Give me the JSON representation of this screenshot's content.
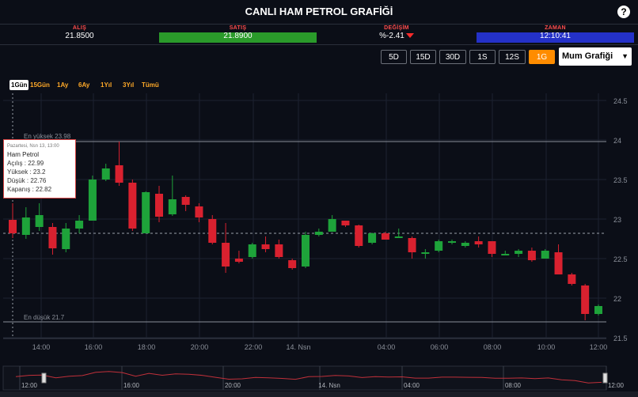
{
  "header": {
    "title": "CANLI HAM PETROL GRAFİĞİ",
    "help_label": "?"
  },
  "stats": {
    "bid_label": "ALIŞ",
    "bid_value": "21.8500",
    "ask_label": "SATIŞ",
    "ask_value": "21.8900",
    "change_label": "DEĞİŞİM",
    "change_value": "%-2.41",
    "time_label": "ZAMAN",
    "time_value": "12:10:41"
  },
  "colors": {
    "up": "#1ea33a",
    "down": "#d9212f",
    "accent": "#ff8c00",
    "ask_bar": "#2a9a2a",
    "time_bar": "#2431c8"
  },
  "period_buttons": [
    "5D",
    "15D",
    "30D",
    "1S",
    "12S",
    "1G"
  ],
  "active_period": "1G",
  "chart_type_select": "Mum Grafiği",
  "range_tabs": [
    "1Gün",
    "15Gün",
    "1Ay",
    "6Ay",
    "1Yıl",
    "3Yıl",
    "Tümü"
  ],
  "active_range": "1Gün",
  "tooltip": {
    "date": "Pazartesi, Nsn 13, 13:00",
    "name": "Ham Petrol",
    "open": "Açılış : 22.99",
    "high": "Yüksek : 23.2",
    "low": "Düşük : 22.76",
    "close": "Kapanış : 22.82"
  },
  "chart_data": {
    "type": "candlestick",
    "title": "",
    "y_ticks": [
      "21.5",
      "22",
      "22.5",
      "23",
      "23.5",
      "24",
      "24.5"
    ],
    "ylim": [
      21.5,
      24.5
    ],
    "x_ticks": [
      "14:00",
      "16:00",
      "18:00",
      "20:00",
      "22:00",
      "14. Nsn",
      "04:00",
      "06:00",
      "08:00",
      "10:00",
      "12:00"
    ],
    "high_line": {
      "label": "En yüksek 23.98",
      "value": 23.98
    },
    "low_line": {
      "label": "En düşük 21.7",
      "value": 21.7
    },
    "current_price": 22.82,
    "candles": [
      {
        "o": 22.99,
        "h": 23.2,
        "l": 22.76,
        "c": 22.82
      },
      {
        "o": 22.8,
        "h": 23.15,
        "l": 22.75,
        "c": 23.02
      },
      {
        "o": 22.9,
        "h": 23.2,
        "l": 22.85,
        "c": 23.05
      },
      {
        "o": 22.9,
        "h": 22.95,
        "l": 22.55,
        "c": 22.63
      },
      {
        "o": 22.62,
        "h": 22.95,
        "l": 22.58,
        "c": 22.88
      },
      {
        "o": 22.88,
        "h": 23.05,
        "l": 22.82,
        "c": 22.98
      },
      {
        "o": 22.98,
        "h": 23.55,
        "l": 22.98,
        "c": 23.5
      },
      {
        "o": 23.5,
        "h": 23.7,
        "l": 23.48,
        "c": 23.64
      },
      {
        "o": 23.68,
        "h": 23.98,
        "l": 23.42,
        "c": 23.46
      },
      {
        "o": 23.46,
        "h": 23.5,
        "l": 22.85,
        "c": 22.88
      },
      {
        "o": 22.82,
        "h": 23.35,
        "l": 22.82,
        "c": 23.34
      },
      {
        "o": 23.32,
        "h": 23.42,
        "l": 22.96,
        "c": 23.03
      },
      {
        "o": 23.06,
        "h": 23.55,
        "l": 23.04,
        "c": 23.25
      },
      {
        "o": 23.28,
        "h": 23.3,
        "l": 23.1,
        "c": 23.18
      },
      {
        "o": 23.16,
        "h": 23.2,
        "l": 22.96,
        "c": 23.02
      },
      {
        "o": 23.0,
        "h": 23.05,
        "l": 22.68,
        "c": 22.7
      },
      {
        "o": 22.7,
        "h": 22.95,
        "l": 22.32,
        "c": 22.4
      },
      {
        "o": 22.5,
        "h": 22.6,
        "l": 22.44,
        "c": 22.46
      },
      {
        "o": 22.52,
        "h": 22.7,
        "l": 22.5,
        "c": 22.68
      },
      {
        "o": 22.68,
        "h": 22.78,
        "l": 22.58,
        "c": 22.62
      },
      {
        "o": 22.68,
        "h": 22.74,
        "l": 22.5,
        "c": 22.52
      },
      {
        "o": 22.48,
        "h": 22.5,
        "l": 22.36,
        "c": 22.38
      },
      {
        "o": 22.4,
        "h": 22.84,
        "l": 22.38,
        "c": 22.8
      },
      {
        "o": 22.8,
        "h": 22.88,
        "l": 22.78,
        "c": 22.84
      },
      {
        "o": 22.84,
        "h": 23.05,
        "l": 22.84,
        "c": 23.0
      },
      {
        "o": 22.98,
        "h": 22.98,
        "l": 22.9,
        "c": 22.92
      },
      {
        "o": 22.92,
        "h": 22.93,
        "l": 22.64,
        "c": 22.66
      },
      {
        "o": 22.7,
        "h": 22.83,
        "l": 22.68,
        "c": 22.82
      },
      {
        "o": 22.82,
        "h": 22.84,
        "l": 22.74,
        "c": 22.74
      },
      {
        "o": 22.78,
        "h": 22.88,
        "l": 22.76,
        "c": 22.78
      },
      {
        "o": 22.76,
        "h": 22.78,
        "l": 22.5,
        "c": 22.58
      },
      {
        "o": 22.56,
        "h": 22.62,
        "l": 22.5,
        "c": 22.58
      },
      {
        "o": 22.6,
        "h": 22.74,
        "l": 22.58,
        "c": 22.72
      },
      {
        "o": 22.7,
        "h": 22.74,
        "l": 22.68,
        "c": 22.72
      },
      {
        "o": 22.66,
        "h": 22.72,
        "l": 22.64,
        "c": 22.7
      },
      {
        "o": 22.72,
        "h": 22.78,
        "l": 22.64,
        "c": 22.68
      },
      {
        "o": 22.72,
        "h": 22.72,
        "l": 22.52,
        "c": 22.56
      },
      {
        "o": 22.56,
        "h": 22.6,
        "l": 22.54,
        "c": 22.56
      },
      {
        "o": 22.56,
        "h": 22.62,
        "l": 22.52,
        "c": 22.6
      },
      {
        "o": 22.6,
        "h": 22.64,
        "l": 22.46,
        "c": 22.48
      },
      {
        "o": 22.5,
        "h": 22.62,
        "l": 22.5,
        "c": 22.6
      },
      {
        "o": 22.58,
        "h": 22.68,
        "l": 22.3,
        "c": 22.3
      },
      {
        "o": 22.3,
        "h": 22.32,
        "l": 22.16,
        "c": 22.18
      },
      {
        "o": 22.16,
        "h": 22.18,
        "l": 21.72,
        "c": 21.8
      },
      {
        "o": 21.8,
        "h": 21.92,
        "l": 21.78,
        "c": 21.9
      }
    ],
    "navigator_labels": [
      "12:00",
      "16:00",
      "20:00",
      "14. Nsn",
      "04:00",
      "08:00",
      "12:00"
    ]
  }
}
